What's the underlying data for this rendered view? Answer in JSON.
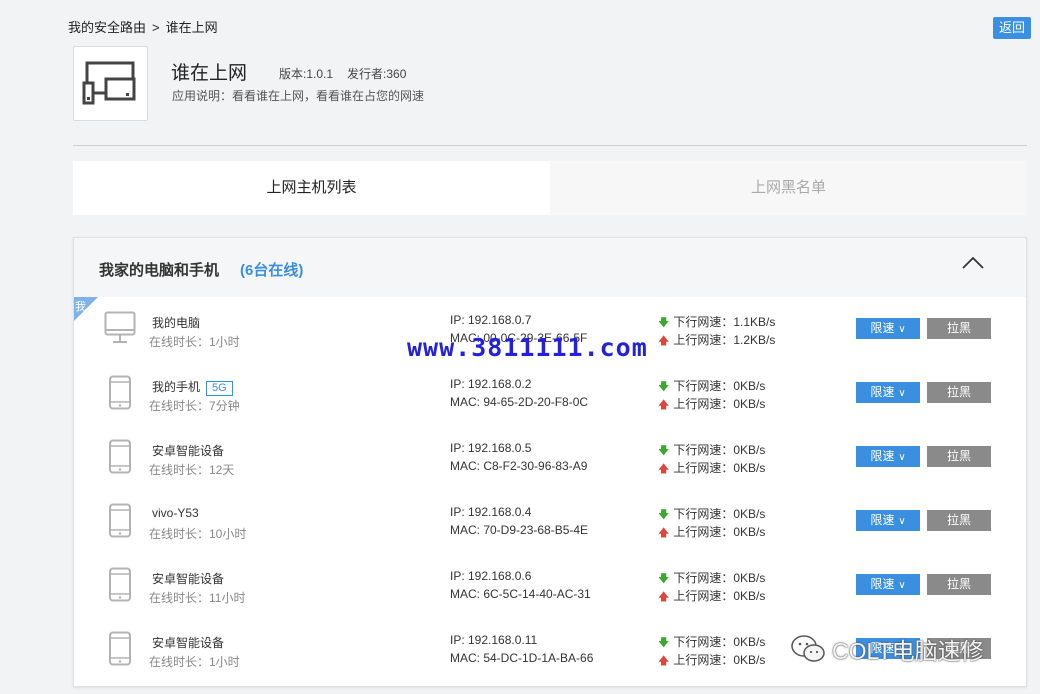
{
  "breadcrumb": {
    "parent": "我的安全路由",
    "separator": ">",
    "current": "谁在上网"
  },
  "back_label": "返回",
  "app": {
    "title": "谁在上网",
    "version": "版本:1.0.1",
    "publisher": "发行者:360",
    "description": "应用说明：看看谁在上网，看看谁在占您的网速"
  },
  "tabs": [
    {
      "label": "上网主机列表",
      "active": true
    },
    {
      "label": "上网黑名单",
      "active": false
    }
  ],
  "panel": {
    "title": "我家的电脑和手机",
    "count": "(6台在线)",
    "me_badge": "我"
  },
  "buttons": {
    "limit": "限速",
    "block": "拉黑"
  },
  "devices": [
    {
      "icon": "desktop-icon",
      "name": "我的电脑",
      "tag": "",
      "online": "在线时长：1小时",
      "ip": "IP: 192.168.0.7",
      "mac": "MAC: 00-0C-29-3E-66-5F",
      "down": "下行网速：1.1KB/s",
      "up": "上行网速：1.2KB/s"
    },
    {
      "icon": "phone-icon",
      "name": "我的手机",
      "tag": "5G",
      "online": "在线时长：7分钟",
      "ip": "IP: 192.168.0.2",
      "mac": "MAC: 94-65-2D-20-F8-0C",
      "down": "下行网速：0KB/s",
      "up": "上行网速：0KB/s"
    },
    {
      "icon": "phone-icon",
      "name": "安卓智能设备",
      "tag": "",
      "online": "在线时长：12天",
      "ip": "IP: 192.168.0.5",
      "mac": "MAC: C8-F2-30-96-83-A9",
      "down": "下行网速：0KB/s",
      "up": "上行网速：0KB/s"
    },
    {
      "icon": "phone-icon",
      "name": "vivo-Y53",
      "tag": "",
      "online": "在线时长：10小时",
      "ip": "IP: 192.168.0.4",
      "mac": "MAC: 70-D9-23-68-B5-4E",
      "down": "下行网速：0KB/s",
      "up": "上行网速：0KB/s"
    },
    {
      "icon": "phone-icon",
      "name": "安卓智能设备",
      "tag": "",
      "online": "在线时长：11小时",
      "ip": "IP: 192.168.0.6",
      "mac": "MAC: 6C-5C-14-40-AC-31",
      "down": "下行网速：0KB/s",
      "up": "上行网速：0KB/s"
    },
    {
      "icon": "phone-icon",
      "name": "安卓智能设备",
      "tag": "",
      "online": "在线时长：1小时",
      "ip": "IP: 192.168.0.11",
      "mac": "MAC: 54-DC-1D-1A-BA-66",
      "down": "下行网速：0KB/s",
      "up": "上行网速：0KB/s"
    }
  ],
  "watermark": "www.3811111.com",
  "wechat_mark": "COLT电脑速修",
  "colors": {
    "accent": "#3b8fe0",
    "down_arrow": "#3aa830",
    "up_arrow": "#e0453a",
    "block_button": "#8a8a8a"
  }
}
